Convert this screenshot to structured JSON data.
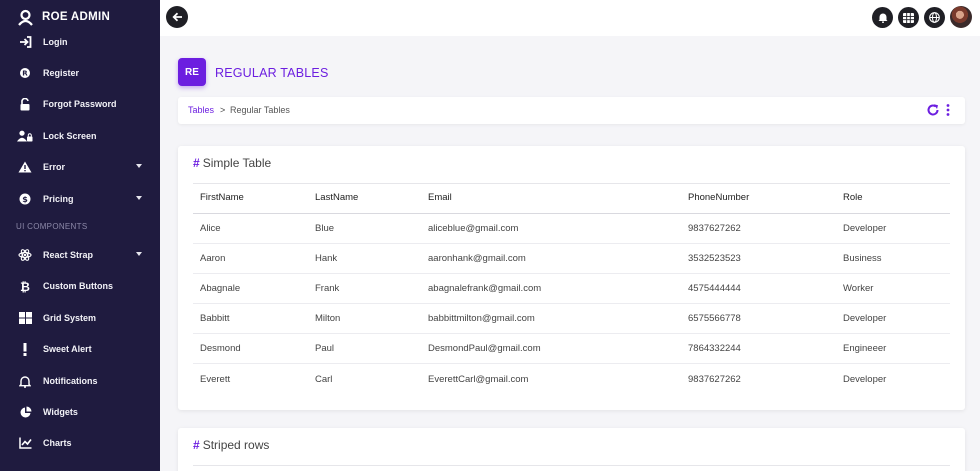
{
  "brand": {
    "title": "ROE ADMIN",
    "logo_icon": "user-avatar-icon"
  },
  "sidebar": {
    "items": [
      {
        "label": "Login",
        "icon": "login-icon"
      },
      {
        "label": "Register",
        "icon": "registered-icon"
      },
      {
        "label": "Forgot Password",
        "icon": "lock-open-icon"
      },
      {
        "label": "Lock Screen",
        "icon": "users-lock-icon"
      },
      {
        "label": "Error",
        "icon": "warning-icon",
        "has_caret": true
      },
      {
        "label": "Pricing",
        "icon": "dollar-icon",
        "has_caret": true
      }
    ],
    "section_label": "UI COMPONENTS",
    "components": [
      {
        "label": "React Strap",
        "icon": "react-icon",
        "has_caret": true
      },
      {
        "label": "Custom Buttons",
        "icon": "bitcoin-icon"
      },
      {
        "label": "Grid System",
        "icon": "grid-icon"
      },
      {
        "label": "Sweet Alert",
        "icon": "exclamation-icon"
      },
      {
        "label": "Notifications",
        "icon": "bell-icon"
      },
      {
        "label": "Widgets",
        "icon": "pie-chart-icon"
      },
      {
        "label": "Charts",
        "icon": "line-chart-icon"
      }
    ]
  },
  "topbar": {
    "back_icon": "arrow-left-icon",
    "icons": [
      "bell-icon",
      "apps-grid-icon",
      "globe-icon"
    ],
    "avatar": "user-avatar"
  },
  "page": {
    "badge": "RE",
    "title": "REGULAR TABLES"
  },
  "breadcrumb": {
    "link": "Tables",
    "separator": ">",
    "current": "Regular Tables"
  },
  "simple_table": {
    "title": "Simple Table",
    "hash": "#",
    "columns": [
      "FirstName",
      "LastName",
      "Email",
      "PhoneNumber",
      "Role"
    ],
    "rows": [
      [
        "Alice",
        "Blue",
        "aliceblue@gmail.com",
        "9837627262",
        "Developer"
      ],
      [
        "Aaron",
        "Hank",
        "aaronhank@gmail.com",
        "3532523523",
        "Business"
      ],
      [
        "Abagnale",
        "Frank",
        "abagnalefrank@gmail.com",
        "4575444444",
        "Worker"
      ],
      [
        "Babbitt",
        "Milton",
        "babbittmilton@gmail.com",
        "6575566778",
        "Developer"
      ],
      [
        "Desmond",
        "Paul",
        "DesmondPaul@gmail.com",
        "7864332244",
        "Engineeer"
      ],
      [
        "Everett",
        "Carl",
        "EverettCarl@gmail.com",
        "9837627262",
        "Developer"
      ]
    ]
  },
  "striped_table": {
    "title": "Striped rows",
    "hash": "#"
  },
  "colors": {
    "sidebar_bg": "#1f1b3f",
    "accent": "#6c1ee0",
    "page_bg": "#f5f5f8"
  }
}
